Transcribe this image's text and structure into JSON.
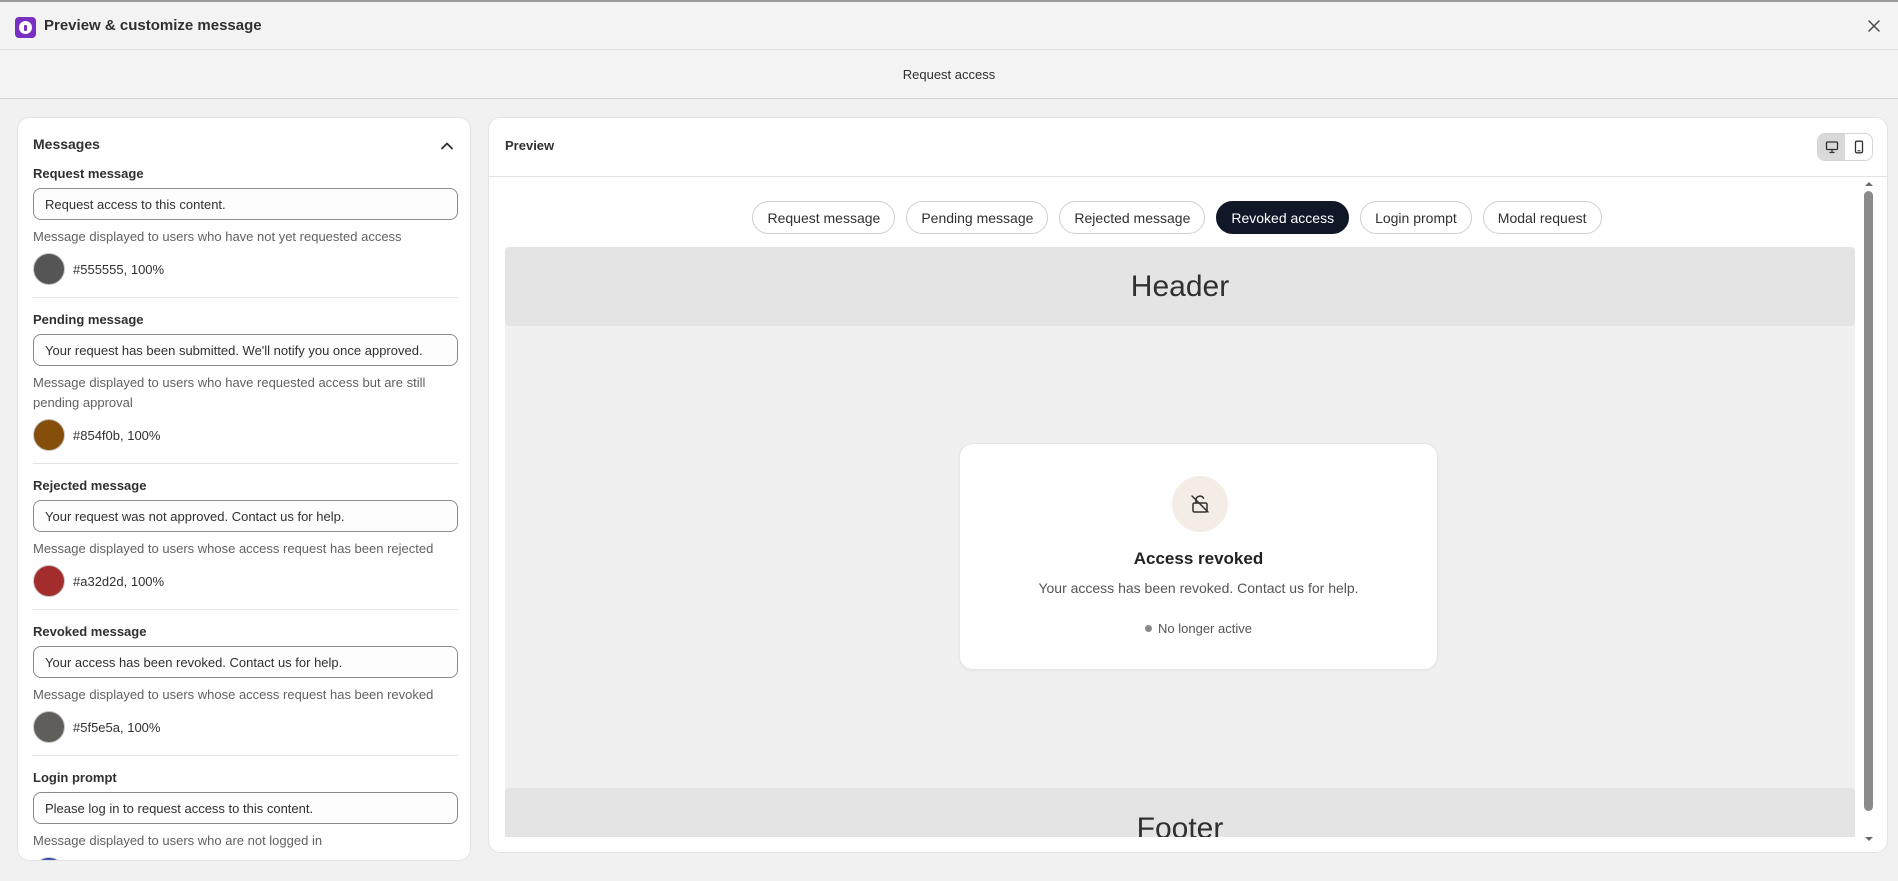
{
  "window": {
    "title": "Preview & customize message",
    "subtitle": "Request access"
  },
  "messages_panel": {
    "title": "Messages",
    "fields": [
      {
        "label": "Request message",
        "value": "Request access to this content.",
        "help": "Message displayed to users who have not yet requested access",
        "color": "#555555",
        "color_text": "#555555, 100%"
      },
      {
        "label": "Pending message",
        "value": "Your request has been submitted. We'll notify you once approved.",
        "help": "Message displayed to users who have requested access but are still pending approval",
        "color": "#854f0b",
        "color_text": "#854f0b, 100%"
      },
      {
        "label": "Rejected message",
        "value": "Your request was not approved. Contact us for help.",
        "help": "Message displayed to users whose access request has been rejected",
        "color": "#a32d2d",
        "color_text": "#a32d2d, 100%"
      },
      {
        "label": "Revoked message",
        "value": "Your access has been revoked. Contact us for help.",
        "help": "Message displayed to users whose access request has been revoked",
        "color": "#5f5e5a",
        "color_text": "#5f5e5a, 100%"
      },
      {
        "label": "Login prompt",
        "value": "Please log in to request access to this content.",
        "help": "Message displayed to users who are not logged in",
        "color": "#3b4fb8"
      }
    ]
  },
  "preview": {
    "title": "Preview",
    "tabs": [
      "Request message",
      "Pending message",
      "Rejected message",
      "Revoked access",
      "Login prompt",
      "Modal request"
    ],
    "active_tab": "Revoked access",
    "header_text": "Header",
    "footer_text": "Footer",
    "card": {
      "icon": "unlock-icon",
      "title": "Access revoked",
      "body": "Your access has been revoked. Contact us for help.",
      "status": "No longer active"
    }
  },
  "icons": {
    "close": "close-icon",
    "collapse": "chevron-up-icon",
    "desktop": "desktop-icon",
    "mobile": "mobile-icon"
  }
}
